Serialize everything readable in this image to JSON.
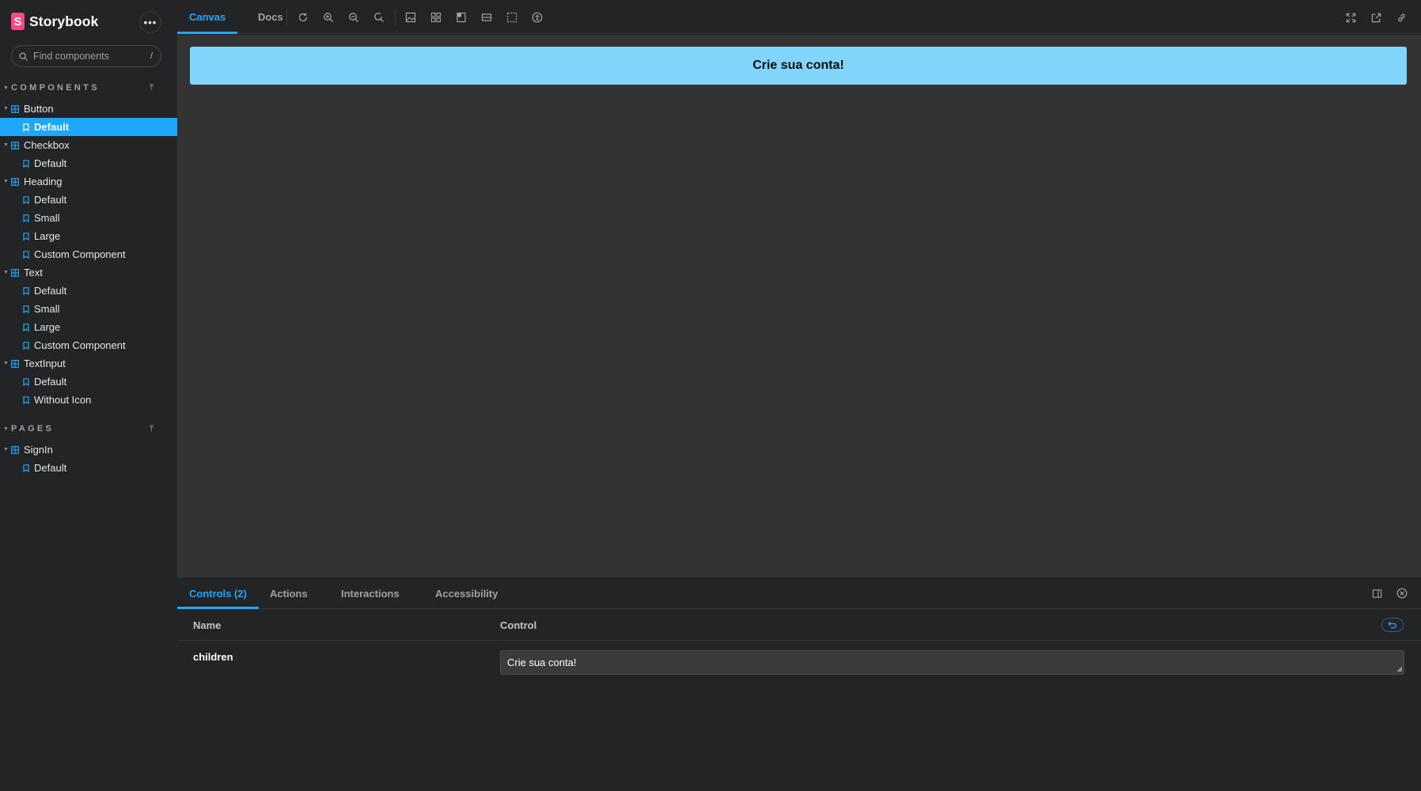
{
  "brand": {
    "name": "Storybook",
    "logo_letter": "S",
    "menu_label": "•••"
  },
  "search": {
    "placeholder": "Find components",
    "shortcut": "/"
  },
  "sidebar": {
    "sections": [
      {
        "title": "COMPONENTS"
      },
      {
        "title": "PAGES"
      }
    ],
    "components": [
      {
        "label": "Button",
        "stories": [
          "Default"
        ]
      },
      {
        "label": "Checkbox",
        "stories": [
          "Default"
        ]
      },
      {
        "label": "Heading",
        "stories": [
          "Default",
          "Small",
          "Large",
          "Custom Component"
        ]
      },
      {
        "label": "Text",
        "stories": [
          "Default",
          "Small",
          "Large",
          "Custom Component"
        ]
      },
      {
        "label": "TextInput",
        "stories": [
          "Default",
          "Without Icon"
        ]
      }
    ],
    "pages": [
      {
        "label": "SignIn",
        "stories": [
          "Default"
        ]
      }
    ],
    "selected_story": "Button / Default"
  },
  "toolbar": {
    "tabs": [
      {
        "label": "Canvas",
        "active": true
      },
      {
        "label": "Docs",
        "active": false
      }
    ],
    "tools": [
      "reload-icon",
      "zoom-in-icon",
      "zoom-out-icon",
      "zoom-reset-icon",
      "background-icon",
      "grid-icon",
      "viewport-icon",
      "measure-icon",
      "outline-icon",
      "accessibility-icon"
    ],
    "right_tools": [
      "fullscreen-icon",
      "open-new-tab-icon",
      "copy-link-icon"
    ]
  },
  "canvas": {
    "button_label": "Crie sua conta!"
  },
  "panel": {
    "tabs": [
      {
        "label": "Controls (2)",
        "active": true
      },
      {
        "label": "Actions",
        "active": false
      },
      {
        "label": "Interactions",
        "active": false
      },
      {
        "label": "Accessibility",
        "active": false
      }
    ],
    "columns": {
      "name": "Name",
      "control": "Control"
    },
    "rows": [
      {
        "name": "children",
        "value": "Crie sua conta!"
      }
    ]
  },
  "colors": {
    "accent": "#1ea7fd",
    "brand": "#ff4785",
    "preview_button": "#81d4fa",
    "canvas_bg": "#333333",
    "chrome_bg": "#222425"
  }
}
